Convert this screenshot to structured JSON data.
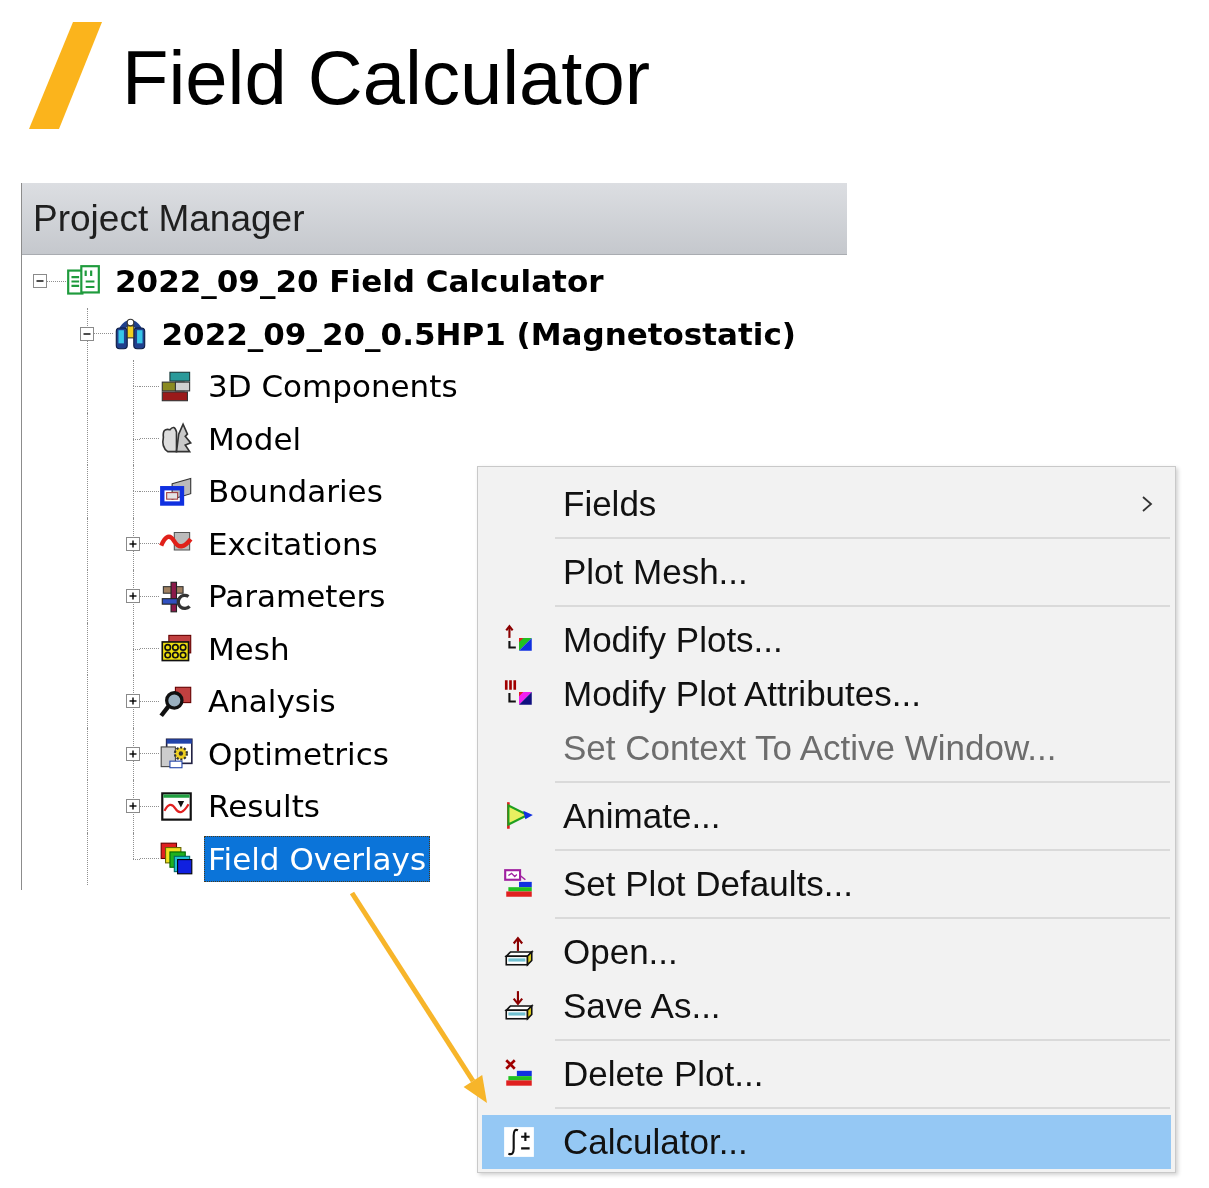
{
  "title": {
    "text": "Field Calculator"
  },
  "panel": {
    "title": "Project Manager",
    "tree": [
      {
        "label": "2022_09_20 Field Calculator",
        "kind": "project",
        "expanded": true,
        "selected": false,
        "children": [
          {
            "label": "2022_09_20_0.5HP1 (Magnetostatic)",
            "kind": "design",
            "expanded": true,
            "selected": false,
            "children": [
              {
                "label": "3D Components",
                "kind": "components",
                "selected": false
              },
              {
                "label": "Model",
                "kind": "model",
                "selected": false
              },
              {
                "label": "Boundaries",
                "kind": "boundaries",
                "selected": false
              },
              {
                "label": "Excitations",
                "kind": "excitations",
                "expanded": false,
                "selected": false
              },
              {
                "label": "Parameters",
                "kind": "parameters",
                "expanded": false,
                "selected": false
              },
              {
                "label": "Mesh",
                "kind": "mesh",
                "selected": false
              },
              {
                "label": "Analysis",
                "kind": "analysis",
                "expanded": false,
                "selected": false
              },
              {
                "label": "Optimetrics",
                "kind": "optimetrics",
                "expanded": false,
                "selected": false
              },
              {
                "label": "Results",
                "kind": "results",
                "expanded": false,
                "selected": false
              },
              {
                "label": "Field Overlays",
                "kind": "overlays",
                "selected": true
              }
            ]
          }
        ]
      }
    ]
  },
  "context_menu": {
    "sections": [
      {
        "items": [
          {
            "label": "Fields",
            "kind": "plain",
            "submenu": true,
            "disabled": false,
            "selected": false
          }
        ]
      },
      {
        "items": [
          {
            "label": "Plot Mesh...",
            "kind": "plain",
            "submenu": false,
            "disabled": false,
            "selected": false
          }
        ]
      },
      {
        "items": [
          {
            "label": "Modify Plots...",
            "kind": "modify",
            "submenu": false,
            "disabled": false,
            "selected": false
          },
          {
            "label": "Modify Plot Attributes...",
            "kind": "attributes",
            "submenu": false,
            "disabled": false,
            "selected": false
          },
          {
            "label": "Set Context To Active Window...",
            "kind": "plain",
            "submenu": false,
            "disabled": true,
            "selected": false
          }
        ]
      },
      {
        "items": [
          {
            "label": "Animate...",
            "kind": "animate",
            "submenu": false,
            "disabled": false,
            "selected": false
          }
        ]
      },
      {
        "items": [
          {
            "label": "Set Plot Defaults...",
            "kind": "defaults",
            "submenu": false,
            "disabled": false,
            "selected": false
          }
        ]
      },
      {
        "items": [
          {
            "label": "Open...",
            "kind": "open",
            "submenu": false,
            "disabled": false,
            "selected": false
          },
          {
            "label": "Save As...",
            "kind": "save",
            "submenu": false,
            "disabled": false,
            "selected": false
          }
        ]
      },
      {
        "items": [
          {
            "label": "Delete Plot...",
            "kind": "delete",
            "submenu": false,
            "disabled": false,
            "selected": false
          }
        ]
      },
      {
        "items": [
          {
            "label": "Calculator...",
            "kind": "calculator",
            "submenu": false,
            "disabled": false,
            "selected": true
          }
        ]
      }
    ]
  },
  "annotations": [
    {
      "kind": "arrow"
    }
  ]
}
